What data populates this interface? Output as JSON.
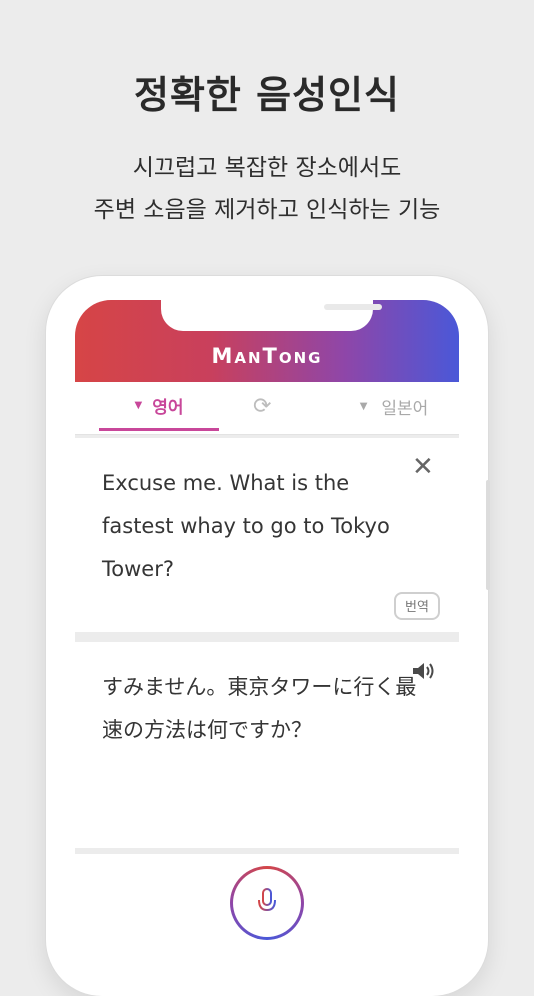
{
  "promo": {
    "headline": "정확한 음성인식",
    "subline1": "시끄럽고 복잡한 장소에서도",
    "subline2": "주변 소음을 제거하고 인식하는 기능"
  },
  "app": {
    "brand": "ManTong",
    "source_language": "영어",
    "target_language": "일본어",
    "source_text": "Excuse me. What is the fastest whay to go to Tokyo Tower?",
    "translate_button": "번역",
    "target_text": "すみません。東京タワーに行く最速の方法は何ですか？",
    "colors": {
      "accent": "#c8479a",
      "gradient_start": "#d64546",
      "gradient_end": "#4a58d8"
    },
    "icons": [
      "caret-down-icon",
      "swap-icon",
      "close-icon",
      "speaker-icon",
      "microphone-icon"
    ]
  }
}
